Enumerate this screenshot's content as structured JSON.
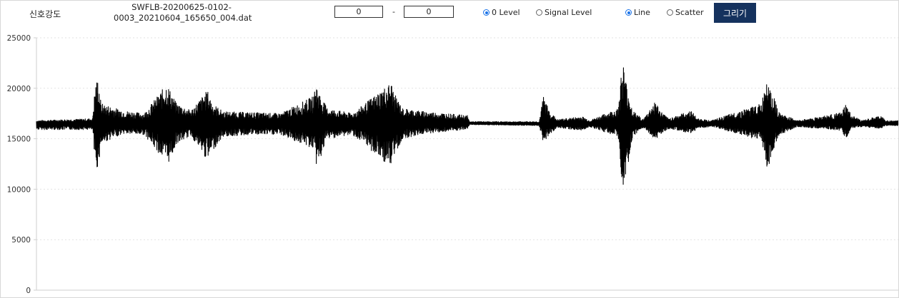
{
  "toolbar": {
    "signal_label": "신호강도",
    "filename_line1": "SWFLB-20200625-0102-",
    "filename_line2": "0003_20210604_165650_004.dat",
    "range_start": "0",
    "range_sep": "-",
    "range_end": "0",
    "level_options": [
      {
        "label": "0 Level",
        "checked": true
      },
      {
        "label": "Signal Level",
        "checked": false
      }
    ],
    "plot_options": [
      {
        "label": "Line",
        "checked": true
      },
      {
        "label": "Scatter",
        "checked": false
      }
    ],
    "draw_button": "그리기",
    "accent_color": "#1a73e8",
    "button_color": "#15325e"
  },
  "chart_data": {
    "type": "line",
    "title": "",
    "xlabel": "",
    "ylabel": "",
    "ylim": [
      0,
      25000
    ],
    "yticks": [
      "25000",
      "20000",
      "15000",
      "10000",
      "5000",
      "0"
    ],
    "ytick_values": [
      25000,
      20000,
      15000,
      10000,
      5000,
      0
    ],
    "grid": "horizontal dotted",
    "line_color": "#000000",
    "baseline": 16500,
    "x_range": [
      0,
      1200
    ],
    "series": [
      {
        "envelope": [
          [
            0,
            16800,
            15900
          ],
          [
            78,
            17000,
            15900
          ],
          [
            82,
            20500,
            12000
          ],
          [
            86,
            21000,
            12200
          ],
          [
            90,
            18500,
            14500
          ],
          [
            120,
            17800,
            15500
          ],
          [
            150,
            17500,
            15400
          ],
          [
            182,
            20500,
            12500
          ],
          [
            186,
            19800,
            12800
          ],
          [
            195,
            18500,
            14500
          ],
          [
            215,
            17800,
            15300
          ],
          [
            238,
            19800,
            12800
          ],
          [
            245,
            18500,
            13800
          ],
          [
            260,
            17700,
            15200
          ],
          [
            300,
            17600,
            15400
          ],
          [
            340,
            17500,
            15400
          ],
          [
            385,
            19200,
            14000
          ],
          [
            390,
            20400,
            12300
          ],
          [
            394,
            19500,
            12800
          ],
          [
            405,
            18000,
            15000
          ],
          [
            440,
            17500,
            15400
          ],
          [
            494,
            20600,
            12100
          ],
          [
            498,
            19500,
            13300
          ],
          [
            510,
            18000,
            15000
          ],
          [
            540,
            17700,
            15500
          ],
          [
            600,
            17300,
            15900
          ],
          [
            603,
            16700,
            16400
          ],
          [
            700,
            16700,
            16300
          ],
          [
            706,
            19300,
            14600
          ],
          [
            714,
            17800,
            15400
          ],
          [
            725,
            16900,
            16100
          ],
          [
            760,
            17200,
            15800
          ],
          [
            770,
            16800,
            16200
          ],
          [
            810,
            18000,
            15200
          ],
          [
            816,
            23000,
            9800
          ],
          [
            820,
            21000,
            11000
          ],
          [
            830,
            17800,
            15000
          ],
          [
            845,
            16900,
            16100
          ],
          [
            862,
            18800,
            14900
          ],
          [
            868,
            17800,
            15400
          ],
          [
            880,
            17000,
            16000
          ],
          [
            912,
            17800,
            15500
          ],
          [
            920,
            17000,
            16000
          ],
          [
            940,
            16800,
            16200
          ],
          [
            1010,
            18500,
            14800
          ],
          [
            1018,
            22300,
            11800
          ],
          [
            1022,
            20000,
            13000
          ],
          [
            1035,
            17500,
            15400
          ],
          [
            1060,
            16800,
            16200
          ],
          [
            1122,
            17600,
            15800
          ],
          [
            1126,
            18500,
            14900
          ],
          [
            1135,
            17300,
            16000
          ],
          [
            1150,
            16800,
            16200
          ],
          [
            1176,
            17300,
            16000
          ],
          [
            1182,
            16800,
            16300
          ],
          [
            1200,
            16800,
            16300
          ]
        ]
      }
    ]
  }
}
